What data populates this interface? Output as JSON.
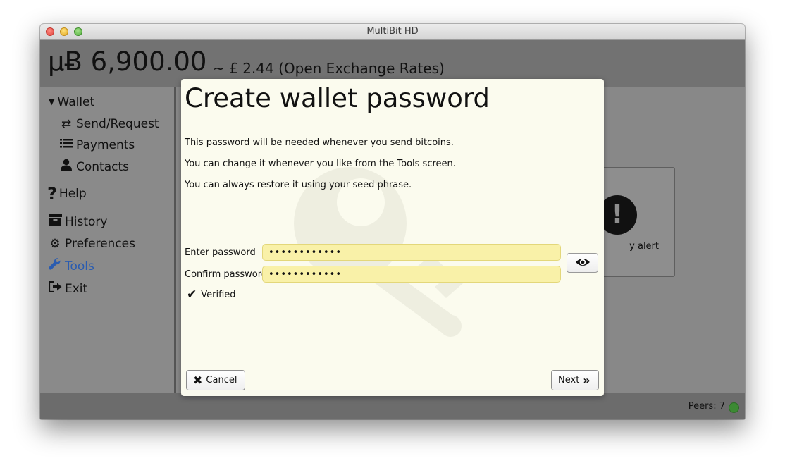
{
  "window": {
    "title": "MultiBit HD"
  },
  "header": {
    "balance_primary": "µɃ 6,900.00",
    "balance_secondary": "~ £ 2.44 (Open Exchange Rates)"
  },
  "sidebar": {
    "items": [
      {
        "label": "Wallet",
        "icon": "caret-down-icon"
      },
      {
        "label": "Send/Request",
        "icon": "exchange-icon"
      },
      {
        "label": "Payments",
        "icon": "list-icon"
      },
      {
        "label": "Contacts",
        "icon": "user-icon"
      },
      {
        "label": "Help",
        "icon": "question-icon"
      },
      {
        "label": "History",
        "icon": "archive-icon"
      },
      {
        "label": "Preferences",
        "icon": "gears-icon"
      },
      {
        "label": "Tools",
        "icon": "wrench-icon"
      },
      {
        "label": "Exit",
        "icon": "sign-out-icon"
      }
    ],
    "active_color": "#2a5cb0"
  },
  "background_card": {
    "label": "y alert"
  },
  "dialog": {
    "title": "Create wallet password",
    "lines": [
      "This password will be needed whenever you send bitcoins.",
      "You can change it whenever you like from the Tools screen.",
      "You can always restore it using your seed phrase."
    ],
    "enter_label": "Enter password",
    "enter_value": "••••••••••••",
    "confirm_label": "Confirm password",
    "confirm_value": "••••••••••••",
    "verified_label": "Verified",
    "cancel_label": "Cancel",
    "next_label": "Next"
  },
  "status": {
    "peers": "Peers: 7",
    "peer_color": "#3c8a33"
  }
}
